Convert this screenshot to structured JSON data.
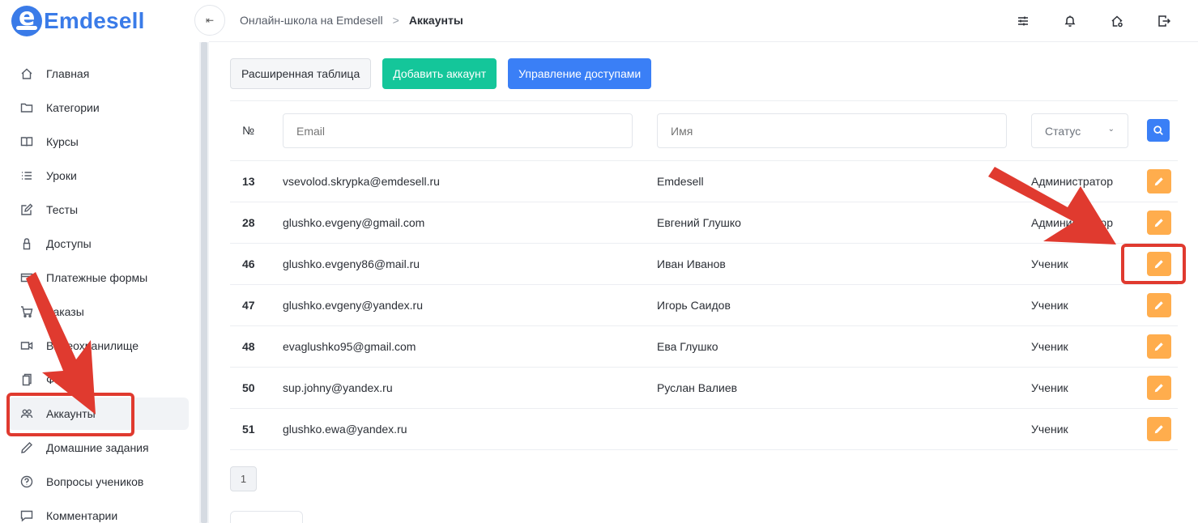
{
  "brand": {
    "logo_letter": "e",
    "name": "Emdesell"
  },
  "sidebar": {
    "items": [
      {
        "label": "Главная",
        "icon": "home-icon"
      },
      {
        "label": "Категории",
        "icon": "folder-icon"
      },
      {
        "label": "Курсы",
        "icon": "book-icon"
      },
      {
        "label": "Уроки",
        "icon": "list-icon"
      },
      {
        "label": "Тесты",
        "icon": "edit-icon"
      },
      {
        "label": "Доступы",
        "icon": "lock-icon"
      },
      {
        "label": "Платежные формы",
        "icon": "card-icon"
      },
      {
        "label": "Заказы",
        "icon": "cart-icon"
      },
      {
        "label": "Видеохранилище",
        "icon": "video-icon"
      },
      {
        "label": "Файлы",
        "icon": "file-icon"
      },
      {
        "label": "Аккаунты",
        "icon": "users-icon",
        "active": true
      },
      {
        "label": "Домашние задания",
        "icon": "pencil-icon"
      },
      {
        "label": "Вопросы учеников",
        "icon": "help-icon"
      },
      {
        "label": "Комментарии",
        "icon": "comment-icon"
      }
    ]
  },
  "header": {
    "collapse_glyph": "⇤",
    "breadcrumb": {
      "parent": "Онлайн-школа на Emdesell",
      "separator": ">",
      "current": "Аккаунты"
    },
    "icons": [
      "sliders-icon",
      "bell-icon",
      "home-settings-icon",
      "logout-icon"
    ]
  },
  "toolbar": {
    "extended_table": "Расширенная таблица",
    "add_account": "Добавить аккаунт",
    "manage_access": "Управление доступами"
  },
  "filters": {
    "num_header": "№",
    "email_placeholder": "Email",
    "name_placeholder": "Имя",
    "status_label": "Статус"
  },
  "accounts": [
    {
      "id": "13",
      "email": "vsevolod.skrypka@emdesell.ru",
      "name": "Emdesell",
      "role": "Администратор"
    },
    {
      "id": "28",
      "email": "glushko.evgeny@gmail.com",
      "name": "Евгений Глушко",
      "role": "Администратор"
    },
    {
      "id": "46",
      "email": "glushko.evgeny86@mail.ru",
      "name": "Иван Иванов",
      "role": "Ученик"
    },
    {
      "id": "47",
      "email": "glushko.evgeny@yandex.ru",
      "name": "Игорь Саидов",
      "role": "Ученик"
    },
    {
      "id": "48",
      "email": "evaglushko95@gmail.com",
      "name": "Ева Глушко",
      "role": "Ученик"
    },
    {
      "id": "50",
      "email": "sup.johny@yandex.ru",
      "name": "Руслан Валиев",
      "role": "Ученик"
    },
    {
      "id": "51",
      "email": "glushko.ewa@yandex.ru",
      "name": "",
      "role": "Ученик"
    }
  ],
  "pagination": {
    "current_page": "1"
  },
  "colors": {
    "accent_blue": "#3a7ff6",
    "green": "#14c69a",
    "edit_orange": "#ffad4d",
    "annotation_red": "#e03a2f"
  }
}
